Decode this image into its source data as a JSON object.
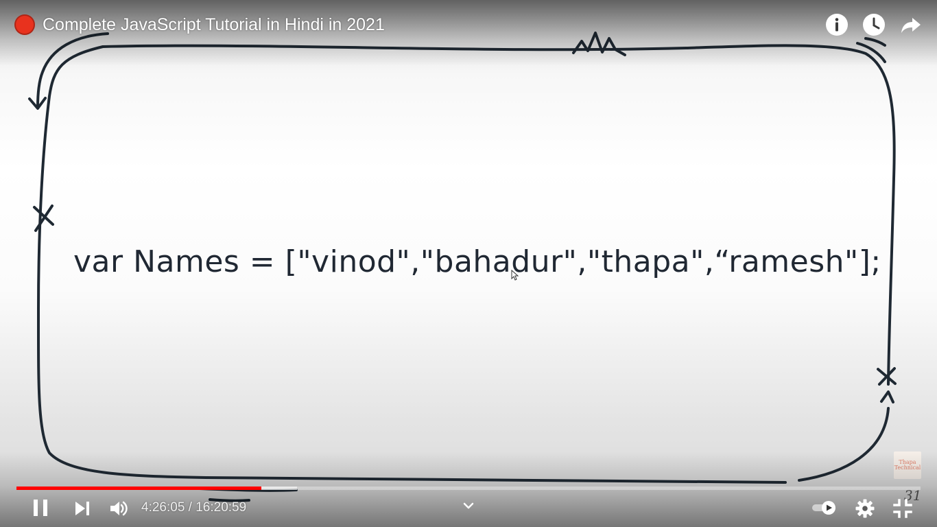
{
  "video": {
    "title": "Complete JavaScript Tutorial in Hindi in 2021",
    "code_line": "var Names = [\"vinod\",\"bahadur\",\"thapa\",“ramesh\"];",
    "watermark_text": "Thapa Technical",
    "frame_number": "31"
  },
  "player": {
    "current_time": "4:26:05",
    "duration": "16:20:59",
    "time_display": "4:26:05 / 16:20:59",
    "progress_fraction": 0.271,
    "buffered_fraction": 0.31,
    "accent_color": "#ff0000"
  },
  "icons": {
    "channel": "channel-avatar-icon",
    "info": "info-icon",
    "watch_later": "clock-icon",
    "share": "share-icon",
    "pause": "pause-icon",
    "next": "next-icon",
    "volume": "volume-icon",
    "chevron": "chevron-down-icon",
    "autoplay": "autoplay-toggle-icon",
    "settings": "gear-icon",
    "exit_fullscreen": "exit-fullscreen-icon"
  }
}
